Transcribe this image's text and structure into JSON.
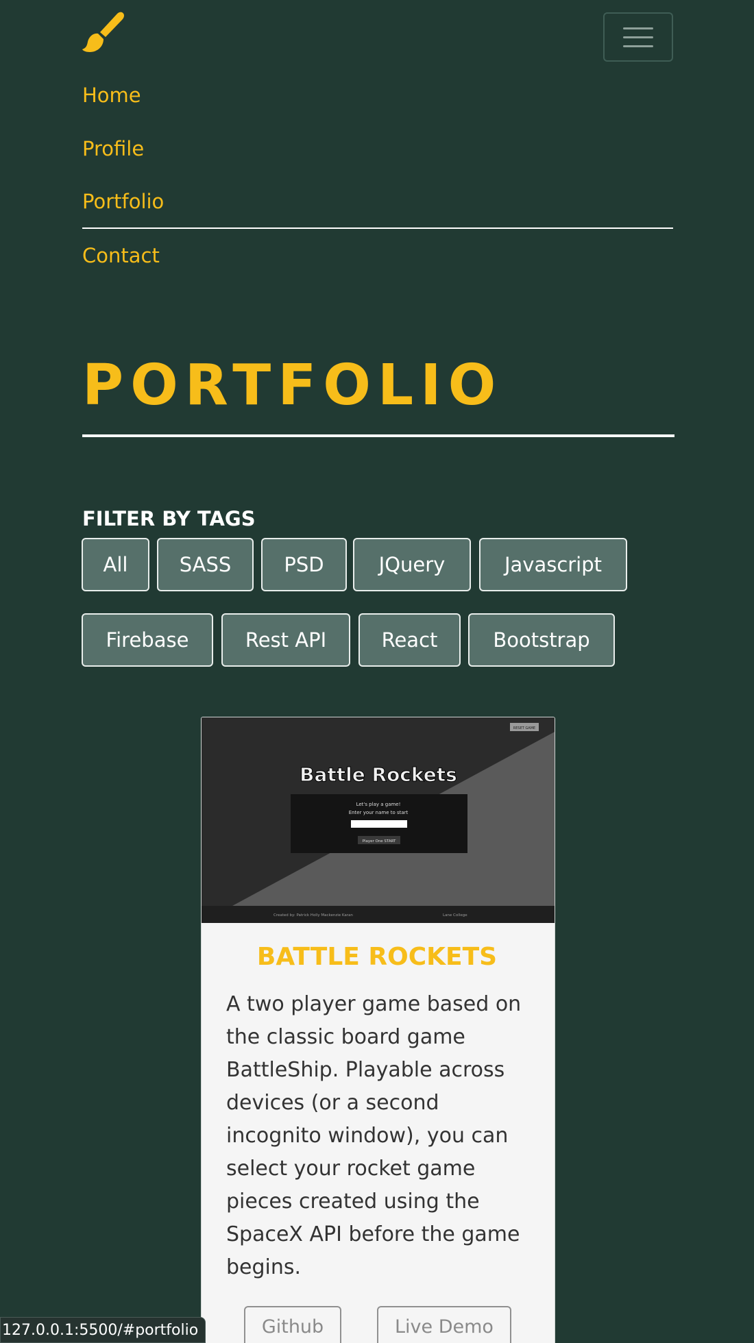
{
  "nav": {
    "items": [
      {
        "label": "Home"
      },
      {
        "label": "Profile"
      },
      {
        "label": "Portfolio"
      },
      {
        "label": "Contact"
      }
    ]
  },
  "portfolio": {
    "title": "PORTFOLIO",
    "filter_label": "FILTER BY TAGS",
    "tags": [
      "All",
      "SASS",
      "PSD",
      "JQuery",
      "Javascript",
      "Firebase",
      "Rest API",
      "React",
      "Bootstrap"
    ]
  },
  "card": {
    "screenshot": {
      "heading": "Battle Rockets",
      "reset_label": "RESET GAME",
      "prompt": "Let's play a game!",
      "subprompt": "Enter your name to start",
      "start_label": "Player One START",
      "footer_left": "Created by: Patrick Holly Mackenzie Karan",
      "footer_right": "Lane College"
    },
    "title": "BATTLE ROCKETS",
    "description": "A two player game based on the classic board game BattleShip. Playable across devices (or a second incognito window), you can select your rocket game pieces created using the SpaceX API before the game begins.",
    "github_label": "Github",
    "demo_label": "Live Demo"
  },
  "status_url": "127.0.0.1:5500/#portfolio",
  "colors": {
    "background": "#213a33",
    "accent": "#f7bd1a",
    "tag_bg": "#56706a"
  }
}
